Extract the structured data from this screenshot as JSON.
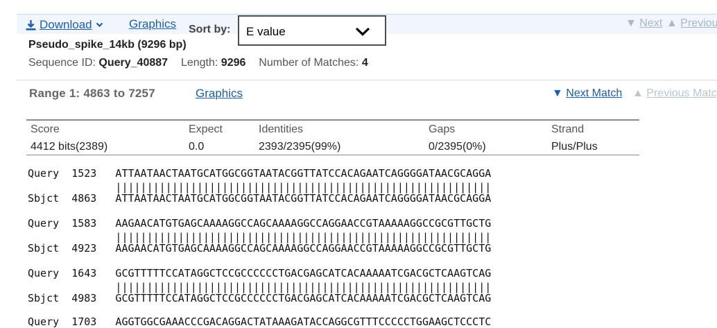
{
  "colors": {
    "link": "#1f5ea8",
    "disabled_link": "#b9c6d2",
    "top_band": "#f0f6fb",
    "muted_text": "#555555"
  },
  "toolbar": {
    "download_label": "Download",
    "download_icon": "download-icon",
    "download_caret_icon": "chevron-down-icon",
    "graphics_label": "Graphics",
    "sort_label": "Sort by:",
    "sort_value": "E value",
    "sort_caret_icon": "chevron-down-icon",
    "next_arrow": "▼",
    "next_label": "Next",
    "prev_arrow": "▲",
    "prev_label": "Previou"
  },
  "sequence": {
    "title": "Pseudo_spike_14kb (9296 bp)",
    "id_label": "Sequence ID:",
    "id_value": "Query_40887",
    "length_label": "Length:",
    "length_value": "9296",
    "matches_label": "Number of Matches:",
    "matches_value": "4"
  },
  "range": {
    "title": "Range 1: 4863 to 7257",
    "graphics_label": "Graphics",
    "next_arrow": "▼",
    "next_label": "Next Match",
    "prev_arrow": "▲",
    "prev_label": "Previous Matc"
  },
  "stats": {
    "headers": [
      "Score",
      "Expect",
      "Identities",
      "Gaps",
      "Strand"
    ],
    "values": [
      "4412 bits(2389)",
      "0.0",
      "2393/2395(99%)",
      "0/2395(0%)",
      "Plus/Plus"
    ]
  },
  "alignment": {
    "blocks": [
      {
        "query": "Query  1523   ATTAATAACTAATGCATGGCGGTAATACGGTTATCCACAGAATCAGGGGATAACGCAGGA",
        "match": "              ||||||||||||||||||||||||||||||||||||||||||||||||||||||||||||",
        "sbjct": "Sbjct  4863   ATTAATAACTAATGCATGGCGGTAATACGGTTATCCACAGAATCAGGGGATAACGCAGGA"
      },
      {
        "query": "Query  1583   AAGAACATGTGAGCAAAAGGCCAGCAAAAGGCCAGGAACCGTAAAAAGGCCGCGTTGCTG",
        "match": "              ||||||||||||||||||||||||||||||||||||||||||||||||||||||||||||",
        "sbjct": "Sbjct  4923   AAGAACATGTGAGCAAAAGGCCAGCAAAAGGCCAGGAACCGTAAAAAGGCCGCGTTGCTG"
      },
      {
        "query": "Query  1643   GCGTTTTTCCATAGGCTCCGCCCCCCTGACGAGCATCACAAAAATCGACGCTCAAGTCAG",
        "match": "              ||||||||||||||||||||||||||||||||||||||||||||||||||||||||||||",
        "sbjct": "Sbjct  4983   GCGTTTTTCCATAGGCTCCGCCCCCCTGACGAGCATCACAAAAATCGACGCTCAAGTCAG"
      },
      {
        "query": "Query  1703   AGGTGGCGAAACCCGACAGGACTATAAAGATACCAGGCGTTTCCCCCTGGAAGCTCCCTC"
      }
    ]
  }
}
